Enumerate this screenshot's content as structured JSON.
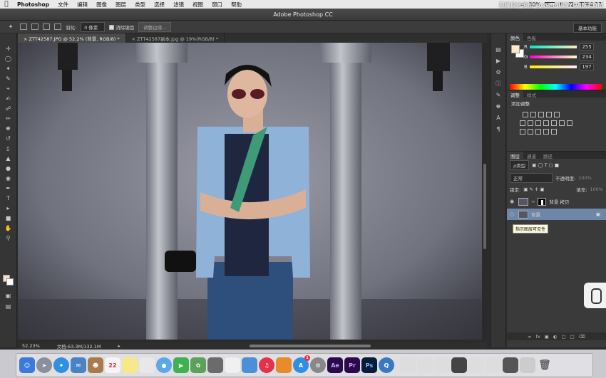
{
  "menubar": {
    "app_name": "Photoshop",
    "items": [
      "文件",
      "编辑",
      "图像",
      "图层",
      "类型",
      "选择",
      "滤镜",
      "视图",
      "窗口",
      "帮助"
    ],
    "battery": "30%",
    "datetime": "周一下午4:18"
  },
  "watermark": "思缘设计论坛 www.MISSYUAN.COM",
  "window": {
    "title": "Adobe Photoshop CC"
  },
  "options": {
    "feather_label": "羽化:",
    "feather_value": "0 像素",
    "antialias_label": "消除锯齿",
    "refine_button": "调整边缘...",
    "workspace": "基本功能"
  },
  "doc_tabs": [
    {
      "label": "ZTT42587.JPG @ 52.2% (背景, RGB/8) *",
      "active": true
    },
    {
      "label": "ZTT42587副本.jpg @ 19%(RGB/8) *",
      "active": false
    }
  ],
  "status": {
    "zoom": "52.23%",
    "doc_size": "文档:63.3M/132.1M"
  },
  "color_panel": {
    "tabs": [
      "颜色",
      "色板"
    ],
    "r_label": "R",
    "r_value": "255",
    "g_label": "G",
    "g_value": "234",
    "b_label": "B",
    "b_value": "197",
    "r_level": 1.0,
    "g_level": 0.92,
    "b_level": 0.77,
    "fg_color": "#ffeac5"
  },
  "adjust_panel": {
    "tabs": [
      "调整",
      "样式"
    ],
    "title": "添加调整"
  },
  "layers_panel": {
    "tabs": [
      "图层",
      "通道",
      "路径"
    ],
    "filter_kind": "ρ类型",
    "blend_mode": "正常",
    "opacity_label": "不透明度:",
    "opacity_value": "100%",
    "lock_label": "锁定:",
    "fill_label": "填充:",
    "fill_value": "100%",
    "layers": [
      {
        "name": "背景 拷贝",
        "selected": false
      },
      {
        "name": "背景",
        "selected": true
      }
    ],
    "tooltip": "指示图层可见性"
  },
  "dock": {
    "calendar_day": "22",
    "app_labels": [
      "Ae",
      "Pr",
      "Ps"
    ],
    "badge": "1"
  }
}
